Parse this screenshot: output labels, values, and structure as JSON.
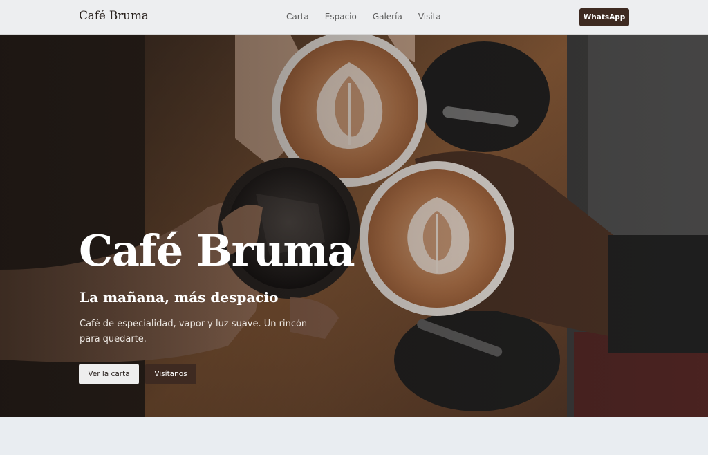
{
  "header": {
    "brand": "Café Bruma",
    "nav": [
      "Carta",
      "Espacio",
      "Galería",
      "Visita"
    ],
    "cta": "WhatsApp"
  },
  "hero": {
    "title": "Café Bruma",
    "subtitle": "La mañana, más despacio",
    "description": "Café de especialidad, vapor y luz suave. Un rincón para quedarte.",
    "primary_button": "Ver la carta",
    "secondary_button": "Visítanos",
    "image": "three coffee cups being toasted by hands"
  },
  "colors": {
    "accent": "#3e2a21",
    "header_bg": "#ecedef",
    "page_bg": "#e9edf1"
  }
}
